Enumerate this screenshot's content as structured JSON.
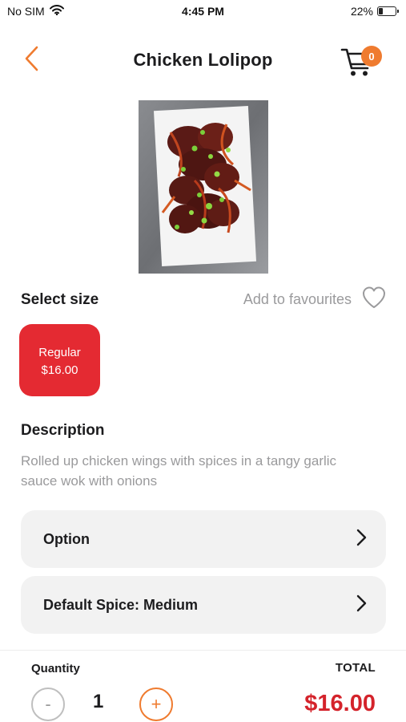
{
  "status_bar": {
    "carrier": "No SIM",
    "time": "4:45 PM",
    "battery_text": "22%",
    "battery_level": 0.22
  },
  "header": {
    "title": "Chicken Lolipop",
    "cart_count": "0"
  },
  "size_section": {
    "label": "Select size",
    "favourites_label": "Add to favourites",
    "sizes": [
      {
        "name": "Regular",
        "price": "$16.00"
      }
    ]
  },
  "description": {
    "heading": "Description",
    "text": "Rolled up chicken wings with spices in a tangy garlic sauce wok with onions"
  },
  "options": [
    {
      "label": "Option"
    },
    {
      "label": "Default Spice: Medium"
    }
  ],
  "bottom_bar": {
    "quantity_label": "Quantity",
    "quantity": "1",
    "minus_symbol": "-",
    "plus_symbol": "+",
    "total_label": "TOTAL",
    "total_value": "$16.00"
  },
  "colors": {
    "accent_orange": "#ef7b2f",
    "size_selected_red": "#e42a32",
    "total_red": "#d4232b"
  },
  "icons": [
    "wifi-icon",
    "battery-icon",
    "back-chevron-icon",
    "cart-icon",
    "heart-icon",
    "chevron-right-icon"
  ]
}
